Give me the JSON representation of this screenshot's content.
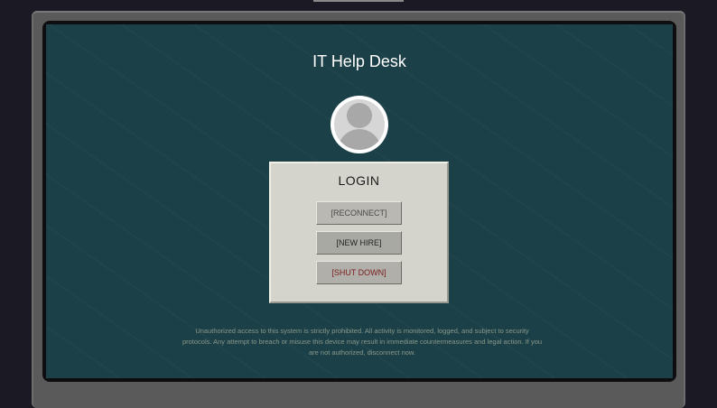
{
  "app": {
    "title": "IT Help Desk"
  },
  "login": {
    "heading": "LOGIN",
    "buttons": {
      "reconnect": "[RECONNECT]",
      "new_hire": "[NEW HIRE]",
      "shut_down": "[SHUT DOWN]"
    }
  },
  "warning_text": "Unauthorized access to this system is strictly prohibited. All activity is monitored, logged, and subject to security protocols. Any attempt to breach or misuse this device may result in immediate countermeasures and legal action. If you are not authorized, disconnect now.",
  "icons": {
    "avatar": "user-avatar-icon"
  },
  "colors": {
    "screen_bg": "#1c4048",
    "panel_bg": "#d5d4cc",
    "shutdown_text": "#7a1e1e"
  }
}
